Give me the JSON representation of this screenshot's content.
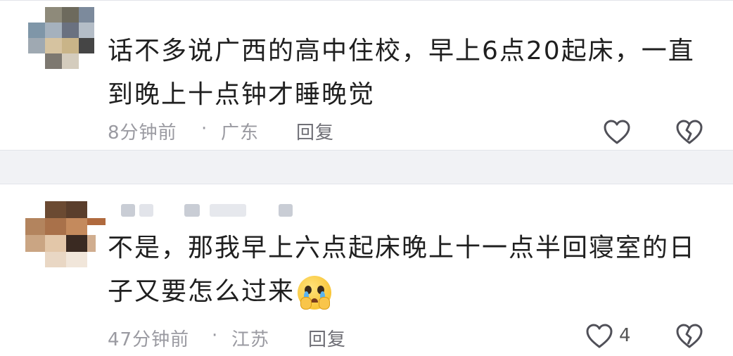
{
  "comments": [
    {
      "text": "话不多说广西的高中住校，早上6点20起床，一直到晚上十点钟才睡晚觉",
      "time": "8分钟前",
      "separator": "·",
      "location": "广东",
      "reply_label": "回复",
      "like_count": ""
    },
    {
      "text": "不是，那我早上六点起床晚上十一点半回寝室的日子又要怎么过来",
      "emoji": "pleading-face-emoji",
      "time": "47分钟前",
      "separator": "·",
      "location": "江苏",
      "reply_label": "回复",
      "like_count": "4"
    }
  ],
  "icons": {
    "like": "heart-outline-icon",
    "dislike": "broken-heart-icon"
  },
  "colors": {
    "background": "#eceef2",
    "card": "#ffffff",
    "text": "#1f1f1f",
    "meta": "#9a9aa1",
    "icon": "#505058"
  }
}
